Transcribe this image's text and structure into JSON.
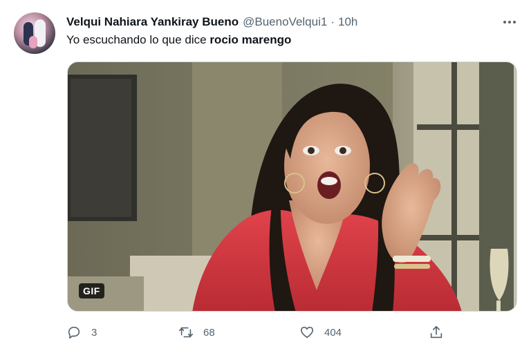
{
  "tweet": {
    "author_name": "Velqui Nahiara Yankiray Bueno",
    "handle": "@BuenoVelqui1",
    "separator": "·",
    "time": "10h",
    "text_plain": "Yo escuchando lo que dice ",
    "text_bold": "rocio marengo"
  },
  "media": {
    "badge": "GIF"
  },
  "actions": {
    "reply_count": "3",
    "retweet_count": "68",
    "like_count": "404"
  },
  "icons": {
    "more": "more-icon",
    "reply": "reply-icon",
    "retweet": "retweet-icon",
    "like": "heart-icon",
    "share": "share-icon"
  },
  "colors": {
    "text": "#0f1419",
    "secondary": "#536471",
    "border": "#cfd9de"
  }
}
